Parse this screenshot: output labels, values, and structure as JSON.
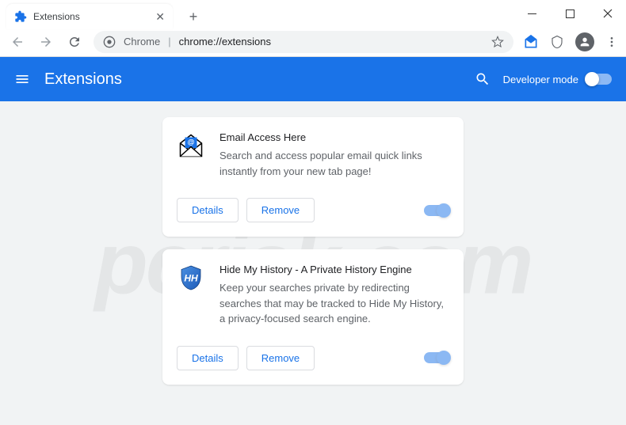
{
  "window": {
    "tab_title": "Extensions"
  },
  "omnibox": {
    "label": "Chrome",
    "url": "chrome://extensions"
  },
  "header": {
    "title": "Extensions",
    "developer_mode": "Developer mode"
  },
  "buttons": {
    "details": "Details",
    "remove": "Remove"
  },
  "extensions": [
    {
      "name": "Email Access Here",
      "description": "Search and access popular email quick links instantly from your new tab page!",
      "enabled": true
    },
    {
      "name": "Hide My History - A Private History Engine",
      "description": "Keep your searches private by redirecting searches that may be tracked to Hide My History, a privacy-focused search engine.",
      "enabled": true
    }
  ],
  "watermark": "pcrisk.com"
}
